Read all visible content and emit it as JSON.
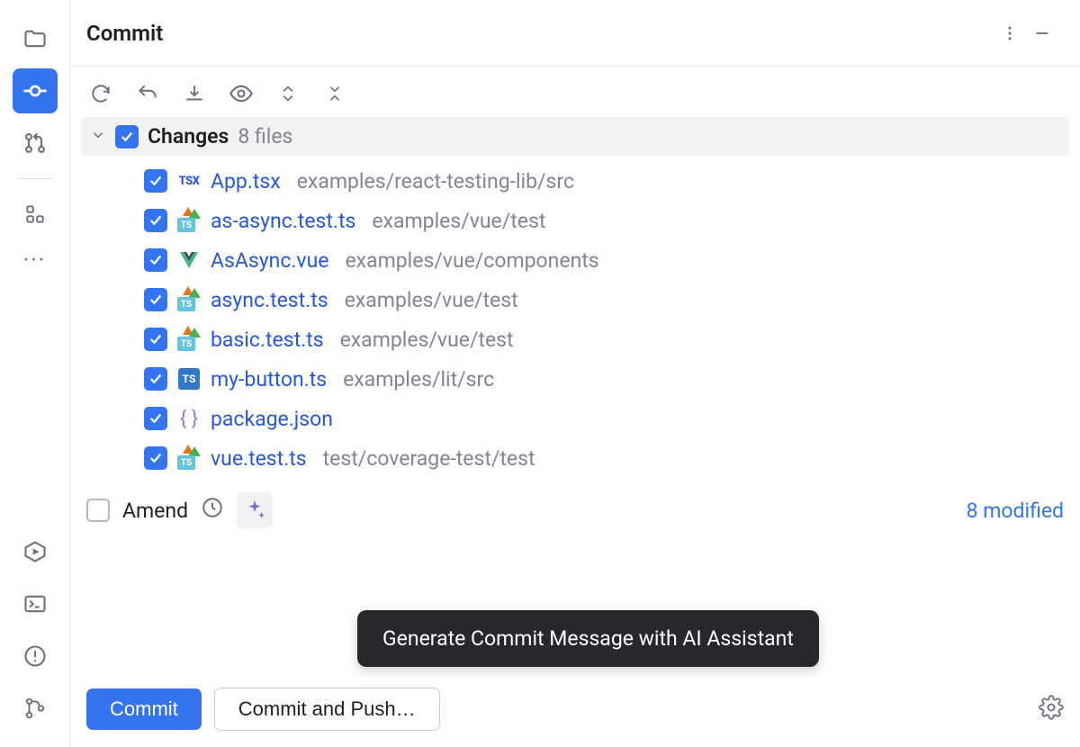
{
  "header": {
    "title": "Commit"
  },
  "changes": {
    "label": "Changes",
    "count": "8 files",
    "files": [
      {
        "icon": "tsx",
        "name": "App.tsx",
        "path": "examples/react-testing-lib/src"
      },
      {
        "icon": "tstest",
        "name": "as-async.test.ts",
        "path": "examples/vue/test"
      },
      {
        "icon": "vue",
        "name": "AsAsync.vue",
        "path": "examples/vue/components"
      },
      {
        "icon": "tstest",
        "name": "async.test.ts",
        "path": "examples/vue/test"
      },
      {
        "icon": "tstest",
        "name": "basic.test.ts",
        "path": "examples/vue/test"
      },
      {
        "icon": "ts",
        "name": "my-button.ts",
        "path": "examples/lit/src"
      },
      {
        "icon": "json",
        "name": "package.json",
        "path": ""
      },
      {
        "icon": "tstest",
        "name": "vue.test.ts",
        "path": "test/coverage-test/test"
      }
    ]
  },
  "amend": {
    "label": "Amend",
    "modified": "8 modified"
  },
  "tooltip": "Generate Commit Message with AI Assistant",
  "footer": {
    "commit": "Commit",
    "commit_push": "Commit and Push…"
  }
}
